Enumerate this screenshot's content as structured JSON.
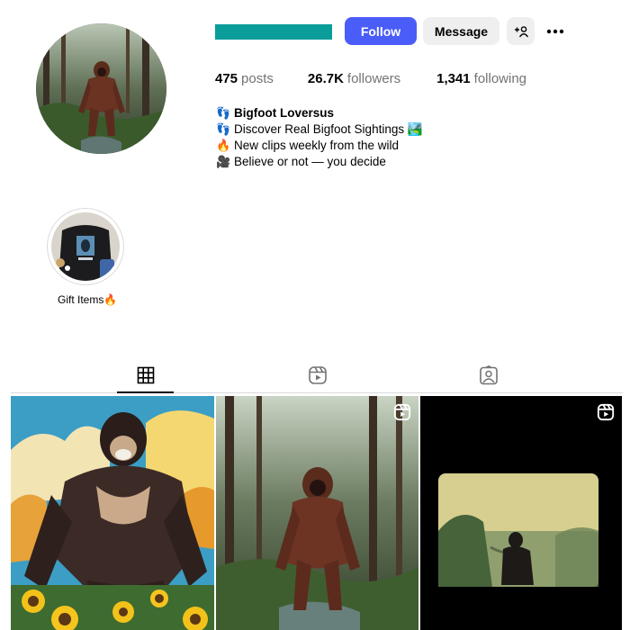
{
  "profile": {
    "username_redacted": true,
    "stats": {
      "posts": {
        "value": "475",
        "label": "posts"
      },
      "followers": {
        "value": "26.7K",
        "label": "followers"
      },
      "following": {
        "value": "1,341",
        "label": "following"
      }
    },
    "bio": [
      {
        "emoji": "👣",
        "text": "Bigfoot Loversus"
      },
      {
        "emoji": "👣",
        "text": "Discover Real Bigfoot Sightings 🏞️"
      },
      {
        "emoji": "🔥",
        "text": "New clips weekly from the wild"
      },
      {
        "emoji": "🎥",
        "text": "Believe or not — you decide"
      }
    ]
  },
  "actions": {
    "follow_label": "Follow",
    "message_label": "Message",
    "suggest_icon": "add-person-icon",
    "more_icon": "more-options-icon"
  },
  "highlights": [
    {
      "label": "Gift Items🔥"
    }
  ],
  "tabs": [
    {
      "name": "posts",
      "icon": "grid-icon",
      "active": true
    },
    {
      "name": "reels",
      "icon": "reels-icon",
      "active": false
    },
    {
      "name": "tagged",
      "icon": "tagged-icon",
      "active": false
    }
  ],
  "grid": [
    {
      "type": "image",
      "depicts": "illustrated gorilla among sunflowers"
    },
    {
      "type": "reel",
      "depicts": "bigfoot standing in a forest"
    },
    {
      "type": "reel",
      "depicts": "grainy bigfoot film frame"
    }
  ],
  "colors": {
    "follow_button": "#4a5df9",
    "secondary_button": "#efefef",
    "username_redaction": "#0a9d9a",
    "muted_text": "#737373"
  }
}
